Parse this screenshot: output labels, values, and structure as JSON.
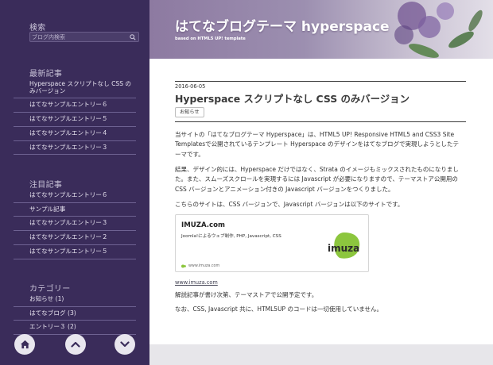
{
  "sidebar": {
    "search_heading": "検索",
    "search_placeholder": "ブログ内検索",
    "recent_heading": "最新記事",
    "recent_items": [
      "Hyperspace スクリプトなし CSS のみバージョン",
      "はてなサンプルエントリー６",
      "はてなサンプルエントリー５",
      "はてなサンプルエントリー４",
      "はてなサンプルエントリー３"
    ],
    "featured_heading": "注目記事",
    "featured_items": [
      "はてなサンプルエントリー６",
      "サンプル記事",
      "はてなサンプルエントリー３",
      "はてなサンプルエントリー２",
      "はてなサンプルエントリー５"
    ],
    "category_heading": "カテゴリー",
    "category_items": [
      "お知らせ (1)",
      "はてなブログ (3)",
      "エントリー３ (2)"
    ],
    "buttons": [
      "home-icon",
      "chevron-up-icon",
      "chevron-down-icon"
    ]
  },
  "header": {
    "title": "はてなブログテーマ hyperspace",
    "subtitle": "based on HTML5 UP! template"
  },
  "post": {
    "date": "2016-06-05",
    "title": "Hyperspace スクリプトなし CSS のみバージョン",
    "tag": "お知らせ",
    "paragraphs": [
      "当サイトの「はてなブログテーマ Hyperspace」は、HTML5 UP! Responsive HTML5 and CSS3 Site Templatesで公開されているテンプレート Hyperspace のデザインをはてなブログで実現しようとしたテーマです。",
      "結果、デザイン的には、Hyperspace だけではなく、Strata のイメージもミックスされたものになりました。また、スムーズスクロールを実現するには Javascript が必要になりますので、テーマストア公開用の CSS バージョンとアニメーション付きの Javascript バージョンをつくりました。",
      "こちらのサイトは、CSS バージョンで、Javascript バージョンは以下のサイトです。"
    ],
    "embed": {
      "title": "IMUZA.com",
      "description": "Joomla!によるウェブ制作, PHP, Javascript, CSS",
      "url": "www.imuza.com",
      "logo_text": "imuza"
    },
    "link_text": "www.imuza.com",
    "after_paragraphs": [
      "解説記事が書け次第、テーマストアで公開予定です。",
      "なお、CSS, Javascript 共に、HTML5UP のコードは一切使用していません。"
    ]
  },
  "colors": {
    "sidebar_bg": "#3a2c5a",
    "banner_bg": "#9c8fb0",
    "logo_green": "#8cc63e"
  }
}
